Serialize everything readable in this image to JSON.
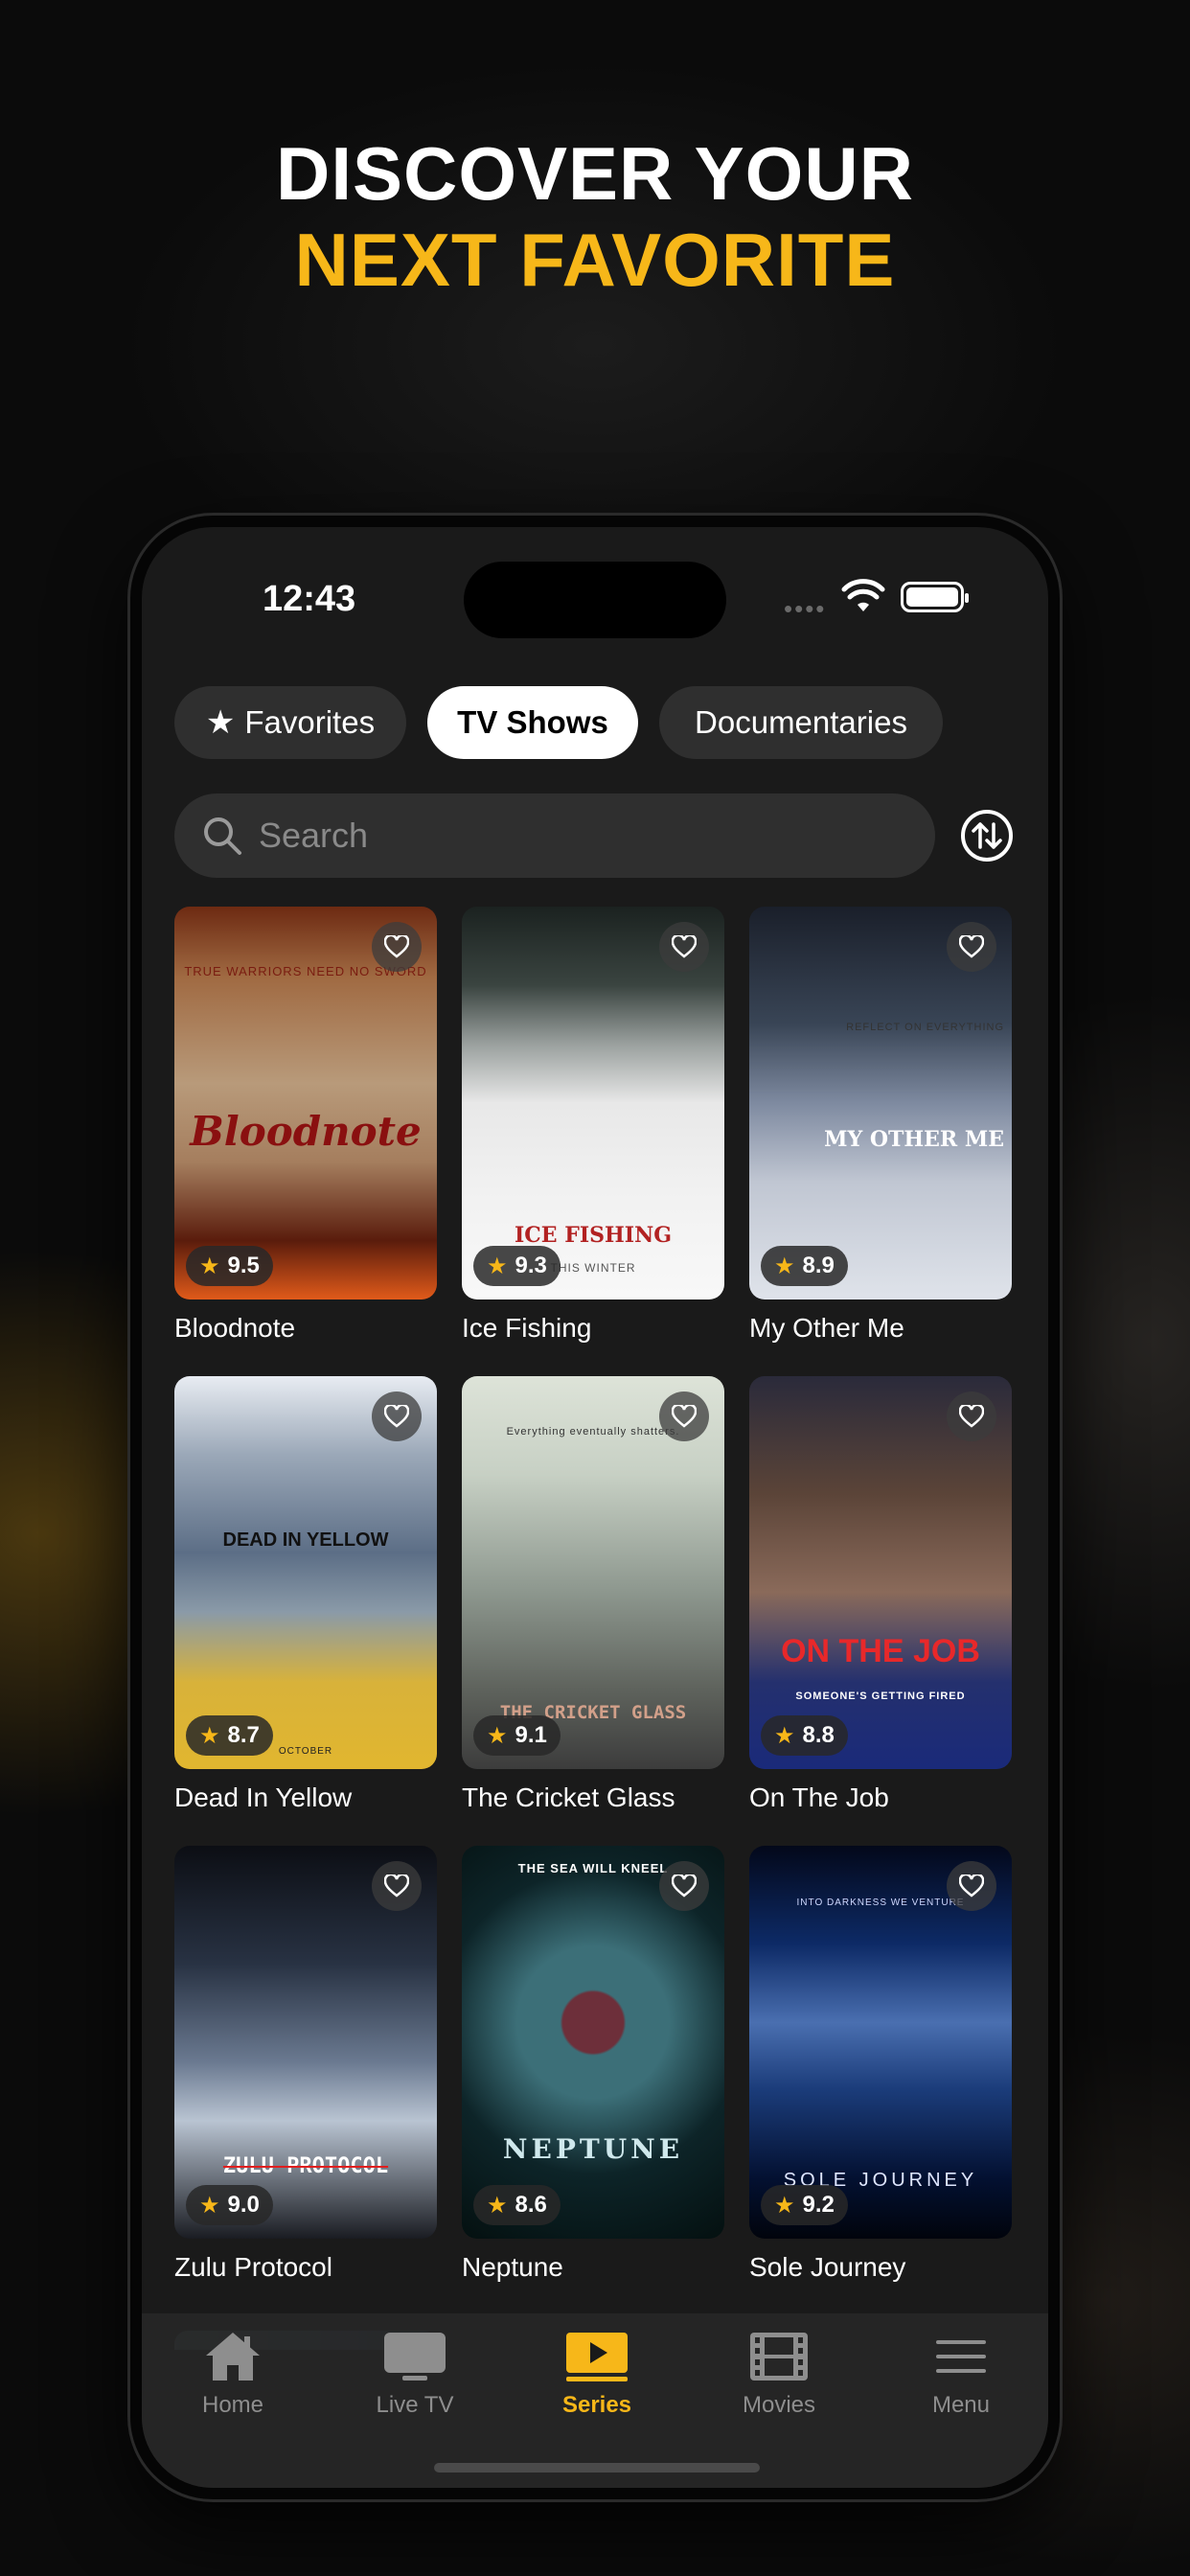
{
  "headline": {
    "line1": "DISCOVER YOUR",
    "line2": "NEXT FAVORITE"
  },
  "colors": {
    "accent": "#f7b719",
    "background": "#0b0b0b",
    "chip_bg": "#2f2f2f"
  },
  "status_bar": {
    "time": "12:43",
    "dots": "••••"
  },
  "category_tabs": [
    {
      "label": "Favorites",
      "icon": "star-icon",
      "active": false
    },
    {
      "label": "TV Shows",
      "active": true
    },
    {
      "label": "Documentaries",
      "active": false
    }
  ],
  "search": {
    "placeholder": "Search"
  },
  "shows": [
    {
      "title": "Bloodnote",
      "rating": "9.5",
      "poster_text": "Bloodnote",
      "poster_tag": "TRUE WARRIORS NEED NO SWORD"
    },
    {
      "title": "Ice Fishing",
      "rating": "9.3",
      "poster_text": "ICE FISHING",
      "poster_tag": "THIS WINTER"
    },
    {
      "title": "My Other Me",
      "rating": "8.9",
      "poster_text": "MY OTHER ME",
      "poster_tag": "REFLECT ON EVERYTHING"
    },
    {
      "title": "Dead In Yellow",
      "rating": "8.7",
      "poster_text": "DEAD IN YELLOW",
      "poster_tag": "OCTOBER"
    },
    {
      "title": "The Cricket Glass",
      "rating": "9.1",
      "poster_text": "THE CRICKET GLASS",
      "poster_tag": "Everything eventually shatters."
    },
    {
      "title": "On The Job",
      "rating": "8.8",
      "poster_text": "ON THE JOB",
      "poster_tag": "SOMEONE'S GETTING FIRED"
    },
    {
      "title": "Zulu Protocol",
      "rating": "9.0",
      "poster_text": "ZULU PROTOCOL",
      "poster_tag": ""
    },
    {
      "title": "Neptune",
      "rating": "8.6",
      "poster_text": "NEPTUNE",
      "poster_tag": "THE SEA WILL KNEEL"
    },
    {
      "title": "Sole Journey",
      "rating": "9.2",
      "poster_text": "SOLE JOURNEY",
      "poster_tag": "INTO DARKNESS WE VENTURE"
    }
  ],
  "bottom_nav": [
    {
      "label": "Home",
      "icon": "home-icon",
      "active": false
    },
    {
      "label": "Live TV",
      "icon": "tv-icon",
      "active": false
    },
    {
      "label": "Series",
      "icon": "play-icon",
      "active": true
    },
    {
      "label": "Movies",
      "icon": "film-icon",
      "active": false
    },
    {
      "label": "Menu",
      "icon": "menu-icon",
      "active": false
    }
  ]
}
